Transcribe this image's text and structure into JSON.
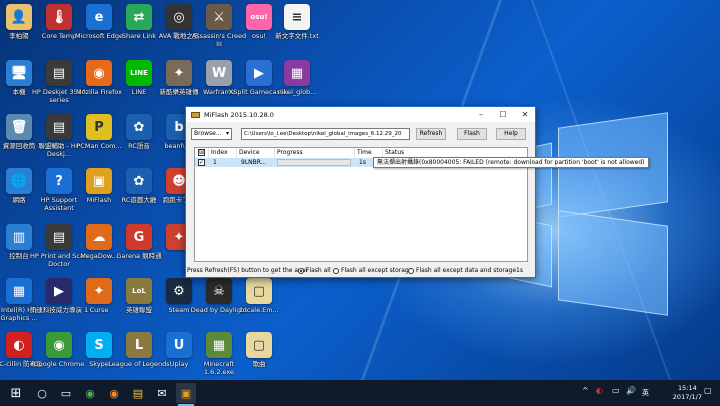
{
  "desktop_icons": [
    {
      "label": "李柏陽",
      "glyph": "👤",
      "color": "#e8c070"
    },
    {
      "label": "Core Temp",
      "glyph": "🌡",
      "color": "#c03030"
    },
    {
      "label": "Microsoft Edge",
      "glyph": "e",
      "color": "#1a6fd4"
    },
    {
      "label": "Share Link",
      "glyph": "⇄",
      "color": "#2aa85a"
    },
    {
      "label": "AVA 戰地之王",
      "glyph": "◎",
      "color": "#333333"
    },
    {
      "label": "Assassin's Creed III",
      "glyph": "⚔",
      "color": "#6b5a4a"
    },
    {
      "label": "osu!",
      "glyph": "osu!",
      "color": "#ff66aa"
    },
    {
      "label": "新文字文件.txt",
      "glyph": "≡",
      "color": "#f4f4f4"
    },
    {
      "label": "本機",
      "glyph": "🖥",
      "color": "#2a7fd4"
    },
    {
      "label": "HP Deskjet 3520 series",
      "glyph": "▤",
      "color": "#3a3a3a"
    },
    {
      "label": "Mozilla Firefox",
      "glyph": "◉",
      "color": "#e66a1a"
    },
    {
      "label": "LINE",
      "glyph": "LINE",
      "color": "#00b900"
    },
    {
      "label": "新酷樂英雄傳",
      "glyph": "✦",
      "color": "#7a6a5a"
    },
    {
      "label": "Warframe",
      "glyph": "W",
      "color": "#9aa0aa"
    },
    {
      "label": "XSplit Gamecaster",
      "glyph": "▶",
      "color": "#2a6fd4"
    },
    {
      "label": "nikel_glob...",
      "glyph": "▦",
      "color": "#8a3aa0"
    },
    {
      "label": "資源回收筒",
      "glyph": "🗑",
      "color": "#5a8ab0"
    },
    {
      "label": "聯盟輔助 - HP Deskj...",
      "glyph": "▤",
      "color": "#3a3a3a"
    },
    {
      "label": "PCMan Com...",
      "glyph": "P",
      "color": "#e0c020"
    },
    {
      "label": "RC語音",
      "glyph": "✿",
      "color": "#1a5fb0"
    },
    {
      "label": "beanfun!",
      "glyph": "b",
      "color": "#1a5fb0"
    },
    {
      "label": "網路",
      "glyph": "🌐",
      "color": "#2a7fd4"
    },
    {
      "label": "HP Support Assistant",
      "glyph": "?",
      "color": "#1a6fd4"
    },
    {
      "label": "MiFlash",
      "glyph": "▣",
      "color": "#e0a020"
    },
    {
      "label": "RC遊戲大廳",
      "glyph": "✿",
      "color": "#1a5fb0"
    },
    {
      "label": "跑跑卡丁車",
      "glyph": "☻",
      "color": "#d04030"
    },
    {
      "label": "控制台",
      "glyph": "▥",
      "color": "#2a7fd4"
    },
    {
      "label": "HP Print and Scan Doctor",
      "glyph": "▤",
      "color": "#3a3a3a"
    },
    {
      "label": "MegaDow...",
      "glyph": "☁",
      "color": "#e06a1a"
    },
    {
      "label": "Garena 競時通",
      "glyph": "G",
      "color": "#d03a2a"
    },
    {
      "label": "",
      "glyph": "✦",
      "color": "#d04030"
    },
    {
      "label": "Intel(R) HD Graphics ...",
      "glyph": "▦",
      "color": "#1a6fd4"
    },
    {
      "label": "訊連科技威力導演 1",
      "glyph": "▶",
      "color": "#2a2a6a"
    },
    {
      "label": "Curse",
      "glyph": "✦",
      "color": "#e06a1a"
    },
    {
      "label": "英雄聯盟",
      "glyph": "LoL",
      "color": "#8a7a40"
    },
    {
      "label": "Steam",
      "glyph": "⚙",
      "color": "#1a2a40"
    },
    {
      "label": "Dead by Daylight",
      "glyph": "☠",
      "color": "#2a2a2a"
    },
    {
      "label": "Locale.Em...",
      "glyph": "▢",
      "color": "#e8d8a0"
    },
    {
      "label": "PC-cillin 防毒版",
      "glyph": "◐",
      "color": "#d02020"
    },
    {
      "label": "Google Chrome",
      "glyph": "◉",
      "color": "#3a9a3a"
    },
    {
      "label": "Skype",
      "glyph": "S",
      "color": "#00aff0"
    },
    {
      "label": "League of Legends",
      "glyph": "L",
      "color": "#8a7a40"
    },
    {
      "label": "Uplay",
      "glyph": "U",
      "color": "#1a6fd4"
    },
    {
      "label": "Minecraft 1.6.2.exe",
      "glyph": "▦",
      "color": "#5a8a3a"
    },
    {
      "label": "歌曲",
      "glyph": "▢",
      "color": "#e8d8a0"
    }
  ],
  "window": {
    "title": "MiFlash 2015.10.28.0",
    "minimize_icon": "–",
    "maximize_icon": "☐",
    "close_icon": "✕",
    "browse_label": "Browse...",
    "browse_arrow": "▾",
    "path_value": "C:\\Users\\lo_l.ee\\Desktop\\nikel_global_images_6.12.29_20",
    "refresh_label": "Refresh",
    "flash_label": "Flash",
    "help_label": "Help",
    "grid": {
      "header_check": "☒",
      "columns": [
        "Index",
        "Device",
        "Progress",
        "Time",
        "Status"
      ],
      "rows": [
        {
          "checked": "✓",
          "index": "1",
          "device": "9LNBR...",
          "progress": "",
          "time": "1s",
          "status": "無法擷出射攝錄(0x80004005: FAILED (remote: download for partition 'boot' is not allowed)"
        }
      ]
    },
    "hint": "Press Refresh(F5) button to get the avai",
    "options": [
      "Flash all",
      "Flash all except storage",
      "Flash all except data and storage"
    ],
    "selected_option": 0,
    "elapsed": "1s"
  },
  "taskbar": {
    "start_icon": "⊞",
    "search_icon": "○",
    "taskview_icon": "▭",
    "apps": [
      "◉",
      "◉",
      "▤",
      "✉",
      "▣"
    ],
    "tray_icons": [
      "^",
      "◐",
      "▭",
      "🔊",
      "英"
    ],
    "time": "15:14",
    "date": "2017/1/7",
    "notification_icon": "▢"
  }
}
